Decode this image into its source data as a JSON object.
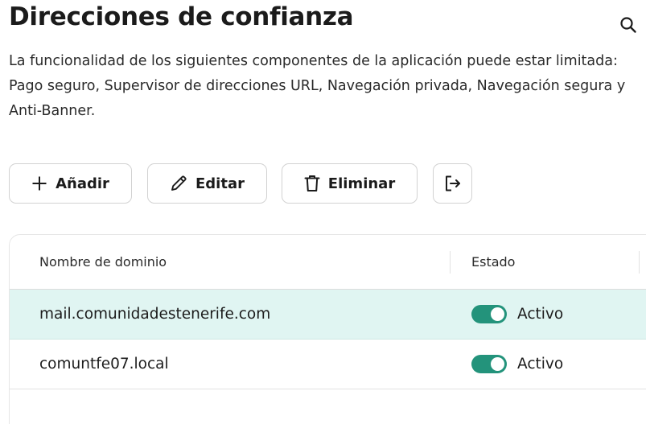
{
  "header": {
    "title": "Direcciones de confianza",
    "search_icon": "search-icon"
  },
  "description": "La funcionalidad de los siguientes componentes de la aplicación puede estar limitada: Pago seguro, Supervisor de direcciones URL, Navegación privada, Navegación segura y Anti-Banner.",
  "toolbar": {
    "add_label": "Añadir",
    "edit_label": "Editar",
    "delete_label": "Eliminar",
    "export_icon": "export-icon"
  },
  "table": {
    "columns": {
      "domain": "Nombre de dominio",
      "status": "Estado"
    },
    "rows": [
      {
        "domain": "mail.comunidadestenerife.com",
        "status": "Activo",
        "enabled": true,
        "selected": true
      },
      {
        "domain": "comuntfe07.local",
        "status": "Activo",
        "enabled": true,
        "selected": false
      }
    ]
  },
  "colors": {
    "toggle_on": "#23937b",
    "selected_row": "#e0f5f2"
  }
}
